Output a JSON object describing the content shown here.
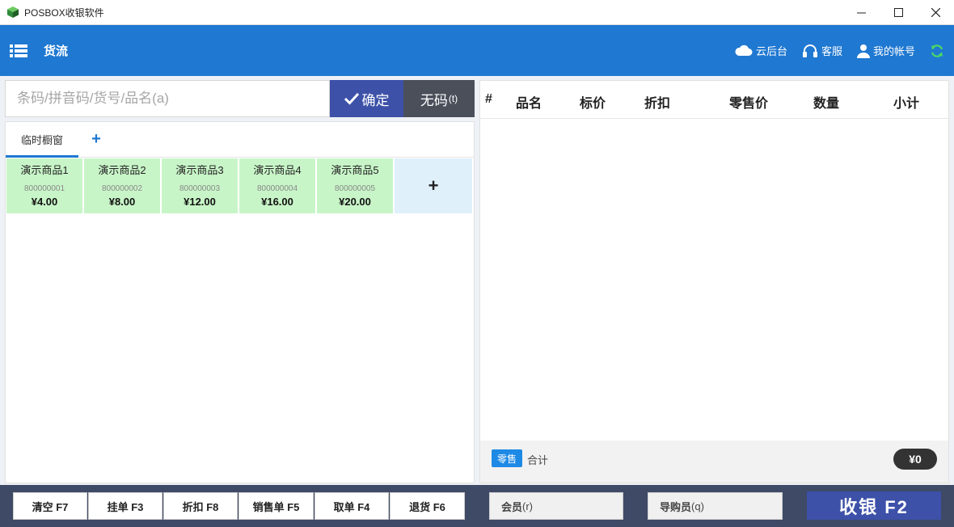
{
  "window": {
    "title": "POSBOX收银软件",
    "icon": "app-box-icon"
  },
  "header": {
    "brand": "货流",
    "cloud_label": "云后台",
    "service_label": "客服",
    "account_label": "我的帐号"
  },
  "search": {
    "placeholder": "条码/拼音码/货号/品名(a)",
    "value": "",
    "confirm_label": "确定",
    "nocode_label": "无码",
    "nocode_hotkey": "(t)"
  },
  "tabs": [
    {
      "label": "临时橱窗",
      "active": true
    }
  ],
  "goods": [
    {
      "name": "演示商品1",
      "code": "800000001",
      "price": "¥4.00"
    },
    {
      "name": "演示商品2",
      "code": "800000002",
      "price": "¥8.00"
    },
    {
      "name": "演示商品3",
      "code": "800000003",
      "price": "¥12.00"
    },
    {
      "name": "演示商品4",
      "code": "800000004",
      "price": "¥16.00"
    },
    {
      "name": "演示商品5",
      "code": "800000005",
      "price": "¥20.00"
    }
  ],
  "cart": {
    "columns": [
      "#",
      "品名",
      "标价",
      "折扣",
      "零售价",
      "数量",
      "小计"
    ],
    "rows": [],
    "mode_badge": "零售",
    "total_label": "合计",
    "total_amount": "¥0"
  },
  "footer": {
    "buttons": [
      "清空 F7",
      "挂单 F3",
      "折扣 F8",
      "销售单 F5",
      "取单 F4",
      "退货 F6"
    ],
    "member_label": "会员",
    "member_hotkey": "(r)",
    "guide_label": "导购员",
    "guide_hotkey": "(q)",
    "checkout_label": "收银 F2"
  },
  "colors": {
    "header": "#1f78d1",
    "confirm": "#3d51a8",
    "footer": "#3e4a66",
    "goods_tile": "#c8f5c8",
    "sync_icon": "#4cd964"
  }
}
